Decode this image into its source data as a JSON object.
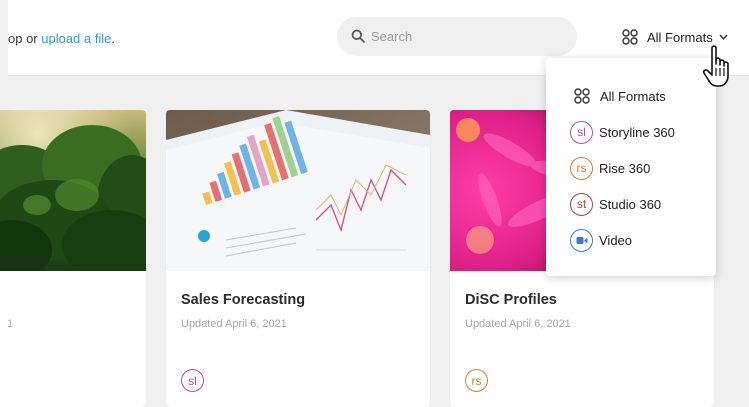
{
  "header": {
    "upload_prefix": "op or ",
    "upload_link": "upload a file",
    "upload_suffix": ".",
    "search_placeholder": "Search",
    "formats_label": "All Formats"
  },
  "dropdown": {
    "items": [
      {
        "label": "All Formats",
        "icon": "grid-icon"
      },
      {
        "label": "Storyline 360",
        "badge": "sl",
        "color": "#b4519f"
      },
      {
        "label": "Rise 360",
        "badge": "rs",
        "color": "#e07a36"
      },
      {
        "label": "Studio 360",
        "badge": "st",
        "color": "#c8363f"
      },
      {
        "label": "Video",
        "icon": "video-icon",
        "color": "#3d7ad6"
      }
    ]
  },
  "cards": [
    {
      "title": "",
      "date": "1",
      "image": "forest-image"
    },
    {
      "title": "Sales Forecasting",
      "date": "Updated April 6, 2021",
      "badge": "sl",
      "badge_color": "#b4519f",
      "image": "charts-paper-image"
    },
    {
      "title": "DiSC Profiles",
      "date": "Updated April 6, 2021",
      "badge": "rs",
      "badge_color": "#e07a36",
      "image": "pink-flower-image"
    }
  ]
}
